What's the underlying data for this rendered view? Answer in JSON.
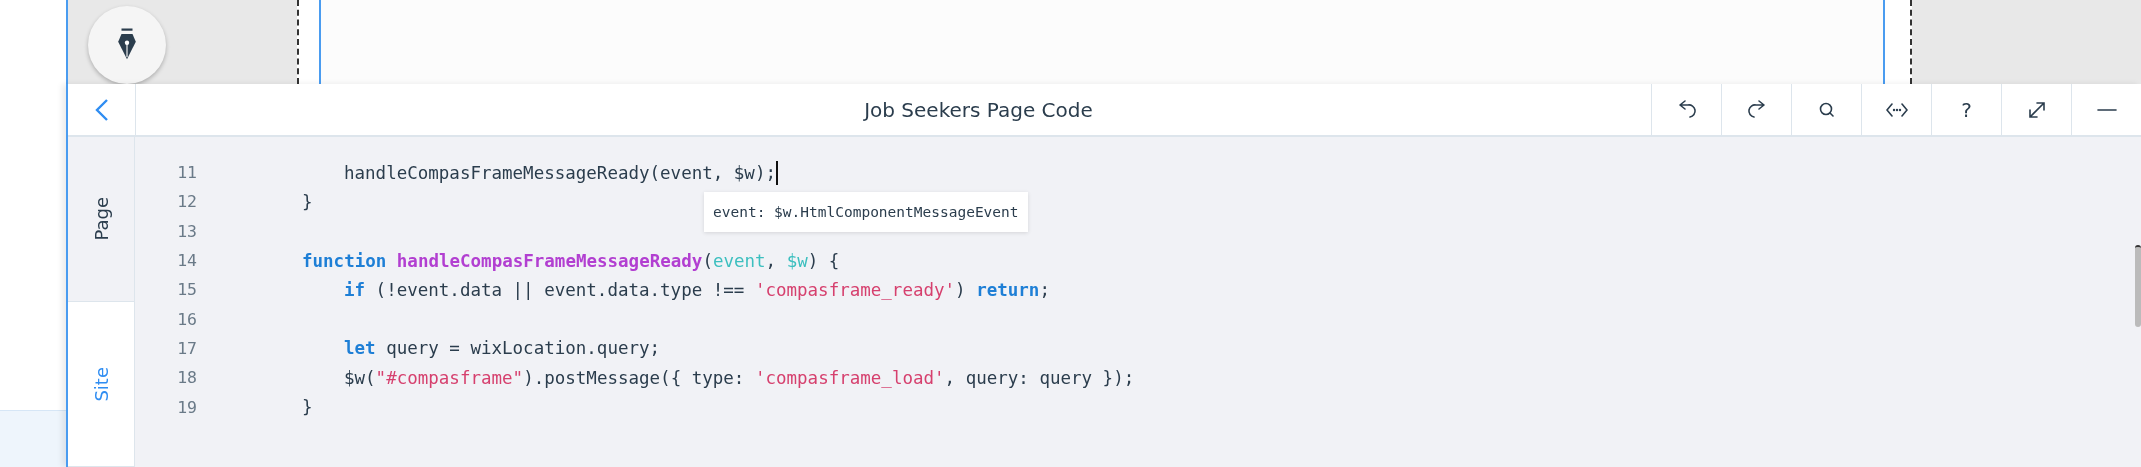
{
  "panel": {
    "title": "Job Seekers Page Code"
  },
  "toolbar": [
    {
      "kind": "undo"
    },
    {
      "kind": "redo"
    },
    {
      "kind": "search"
    },
    {
      "kind": "code"
    },
    {
      "kind": "help",
      "label": "?"
    },
    {
      "kind": "expand"
    },
    {
      "kind": "minimize"
    }
  ],
  "side_tabs": [
    {
      "label": "Page",
      "selected": true
    },
    {
      "label": "Site",
      "selected": false
    }
  ],
  "editor": {
    "lines": [
      {
        "number": "11",
        "cursor": true,
        "indented": true,
        "tokens": [
          {
            "kind": "plain",
            "text": "handleCompasFrameMessageReady(event, $w);"
          }
        ]
      },
      {
        "number": "12",
        "cursor": false,
        "indented": false,
        "tokens": [
          {
            "kind": "plain",
            "text": "}"
          }
        ]
      },
      {
        "number": "13",
        "cursor": false
      },
      {
        "number": "14",
        "cursor": false,
        "indented": false,
        "tokens": [
          {
            "kind": "keyword",
            "text": "function "
          },
          {
            "kind": "function",
            "text": "handleCompasFrameMessageReady"
          },
          {
            "kind": "plain",
            "text": "("
          },
          {
            "kind": "param",
            "text": "event"
          },
          {
            "kind": "plain",
            "text": ", "
          },
          {
            "kind": "param",
            "text": "$w"
          },
          {
            "kind": "plain",
            "text": ") {"
          }
        ]
      },
      {
        "number": "15",
        "cursor": false,
        "indented": true,
        "tokens": [
          {
            "kind": "keyword",
            "text": "if"
          },
          {
            "kind": "plain",
            "text": " (!event.data || event.data.type !== "
          },
          {
            "kind": "string",
            "text": "'compasframe_ready'"
          },
          {
            "kind": "plain",
            "text": ") "
          },
          {
            "kind": "keyword",
            "text": "return"
          },
          {
            "kind": "plain",
            "text": ";"
          }
        ]
      },
      {
        "number": "16",
        "cursor": false
      },
      {
        "number": "17",
        "cursor": false,
        "indented": true,
        "tokens": [
          {
            "kind": "keyword",
            "text": "let"
          },
          {
            "kind": "plain",
            "text": " query = wixLocation.query;"
          }
        ]
      },
      {
        "number": "18",
        "cursor": false,
        "indented": true,
        "tokens": [
          {
            "kind": "plain",
            "text": "$w("
          },
          {
            "kind": "string",
            "text": "\"#compasframe\""
          },
          {
            "kind": "plain",
            "text": ").postMessage({ type: "
          },
          {
            "kind": "string",
            "text": "'compasframe_load'"
          },
          {
            "kind": "plain",
            "text": ", query: query });"
          }
        ]
      },
      {
        "number": "19",
        "cursor": false,
        "indented": false,
        "tokens": [
          {
            "kind": "plain",
            "text": "}"
          }
        ]
      }
    ],
    "tooltip": "event: $w.HtmlComponentMessageEvent"
  }
}
